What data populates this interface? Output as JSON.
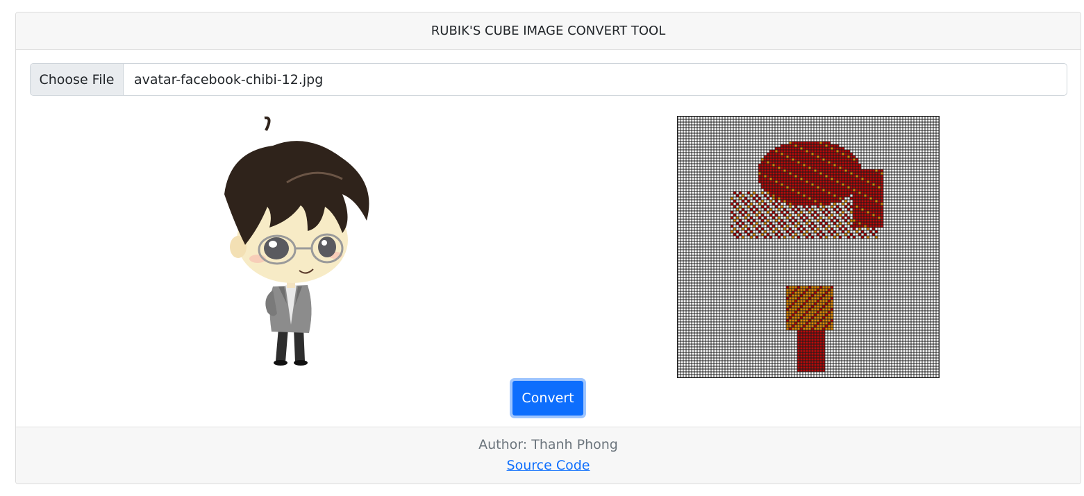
{
  "header": {
    "title": "RUBIK'S CUBE IMAGE CONVERT TOOL"
  },
  "file_input": {
    "button_label": "Choose File",
    "file_name": "avatar-facebook-chibi-12.jpg"
  },
  "original_image": {
    "description": "chibi-avatar"
  },
  "converted_image": {
    "cube_colors": {
      "white": "#ffffff",
      "red": "#b80a0a",
      "orange": "#e08a0a",
      "grid": "#1a1a1a"
    }
  },
  "actions": {
    "convert_label": "Convert"
  },
  "footer": {
    "author": "Author: Thanh Phong",
    "source_link": "Source Code"
  },
  "colors": {
    "accent": "#0d6efd",
    "accent_ring": "#9ec5fe"
  }
}
